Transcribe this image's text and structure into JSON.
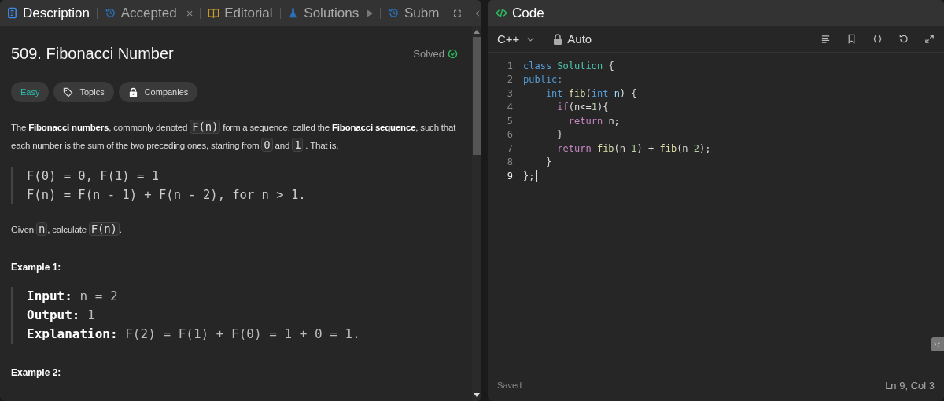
{
  "description_panel": {
    "tabs": [
      {
        "label": "Description",
        "kind": "doc",
        "selected": true
      },
      {
        "label": "Accepted",
        "kind": "history",
        "selected": false,
        "close": "×"
      },
      {
        "label": "Editorial",
        "kind": "book",
        "selected": false
      },
      {
        "label": "Solutions",
        "kind": "flask",
        "selected": false
      },
      {
        "label": "Subm",
        "kind": "history",
        "selected": false
      }
    ],
    "title": "509. Fibonacci Number",
    "status": "Solved",
    "tags": [
      {
        "label": "Easy",
        "kind": "difficulty"
      },
      {
        "label": "Topics",
        "kind": "tag"
      },
      {
        "label": "Companies",
        "kind": "lock"
      }
    ],
    "intro": [
      {
        "kind": "text",
        "text": "The **Fibonacci numbers**, commonly denoted"
      },
      {
        "kind": "code",
        "text": "F(n)"
      },
      {
        "kind": "text",
        "text": "form a sequence, called the **Fibonacci sequence**, such that each number is the sum of the two preceding ones, starting from"
      },
      {
        "kind": "code",
        "text": "0"
      },
      {
        "kind": "text",
        "text": "and"
      },
      {
        "kind": "code",
        "text": "1"
      },
      {
        "kind": "text",
        "text": ". That is,"
      }
    ],
    "formula": [
      "F(0) = 0, F(1) = 1",
      "F(n) = F(n - 1) + F(n - 2), for n > 1."
    ],
    "task": [
      {
        "kind": "text",
        "text": "Given"
      },
      {
        "kind": "code",
        "text": "n"
      },
      {
        "kind": "text",
        "text": ", calculate"
      },
      {
        "kind": "code",
        "text": "F(n)"
      },
      {
        "kind": "text",
        "text": "."
      }
    ],
    "examples": [
      {
        "title": "Example 1:",
        "lines": [
          {
            "label": "Input:",
            "value": "n = 2"
          },
          {
            "label": "Output:",
            "value": "1"
          },
          {
            "label": "Explanation:",
            "value": "F(2) = F(1) + F(0) = 1 + 0 = 1."
          }
        ]
      },
      {
        "title": "Example 2:"
      }
    ]
  },
  "code_panel": {
    "title": "Code",
    "language": "C++",
    "mode": "Auto",
    "lines": [
      {
        "no": "1",
        "current": false,
        "tokens": [
          {
            "kind": "kw",
            "t": "class "
          },
          {
            "kind": "type",
            "t": "Solution"
          },
          {
            "kind": "plain",
            "t": " {"
          }
        ]
      },
      {
        "no": "2",
        "current": false,
        "tokens": [
          {
            "kind": "kw",
            "t": "public:"
          }
        ]
      },
      {
        "no": "3",
        "current": false,
        "tokens": [
          {
            "kind": "kw",
            "t": "    int "
          },
          {
            "kind": "fn",
            "t": "fib"
          },
          {
            "kind": "plain",
            "t": "("
          },
          {
            "kind": "kw",
            "t": "int "
          },
          {
            "kind": "var",
            "t": "n"
          },
          {
            "kind": "plain",
            "t": ") {"
          }
        ]
      },
      {
        "no": "4",
        "current": false,
        "tokens": [
          {
            "kind": "ctrl",
            "t": "      if"
          },
          {
            "kind": "plain",
            "t": "(n<="
          },
          {
            "kind": "num",
            "t": "1"
          },
          {
            "kind": "plain",
            "t": "){"
          }
        ]
      },
      {
        "no": "5",
        "current": false,
        "tokens": [
          {
            "kind": "ctrl",
            "t": "        return"
          },
          {
            "kind": "plain",
            "t": " n;"
          }
        ]
      },
      {
        "no": "6",
        "current": false,
        "tokens": [
          {
            "kind": "plain",
            "t": "      }"
          }
        ]
      },
      {
        "no": "7",
        "current": false,
        "tokens": [
          {
            "kind": "ctrl",
            "t": "      return "
          },
          {
            "kind": "fn",
            "t": "fib"
          },
          {
            "kind": "plain",
            "t": "(n-"
          },
          {
            "kind": "num",
            "t": "1"
          },
          {
            "kind": "plain",
            "t": ") + "
          },
          {
            "kind": "fn",
            "t": "fib"
          },
          {
            "kind": "plain",
            "t": "(n-"
          },
          {
            "kind": "num",
            "t": "2"
          },
          {
            "kind": "plain",
            "t": ");"
          }
        ]
      },
      {
        "no": "8",
        "current": false,
        "tokens": [
          {
            "kind": "plain",
            "t": "    }"
          }
        ]
      },
      {
        "no": "9",
        "current": true,
        "tokens": [
          {
            "kind": "plain",
            "t": "};"
          }
        ]
      }
    ],
    "save_status": "Saved",
    "cursor": "Ln 9, Col 3"
  }
}
